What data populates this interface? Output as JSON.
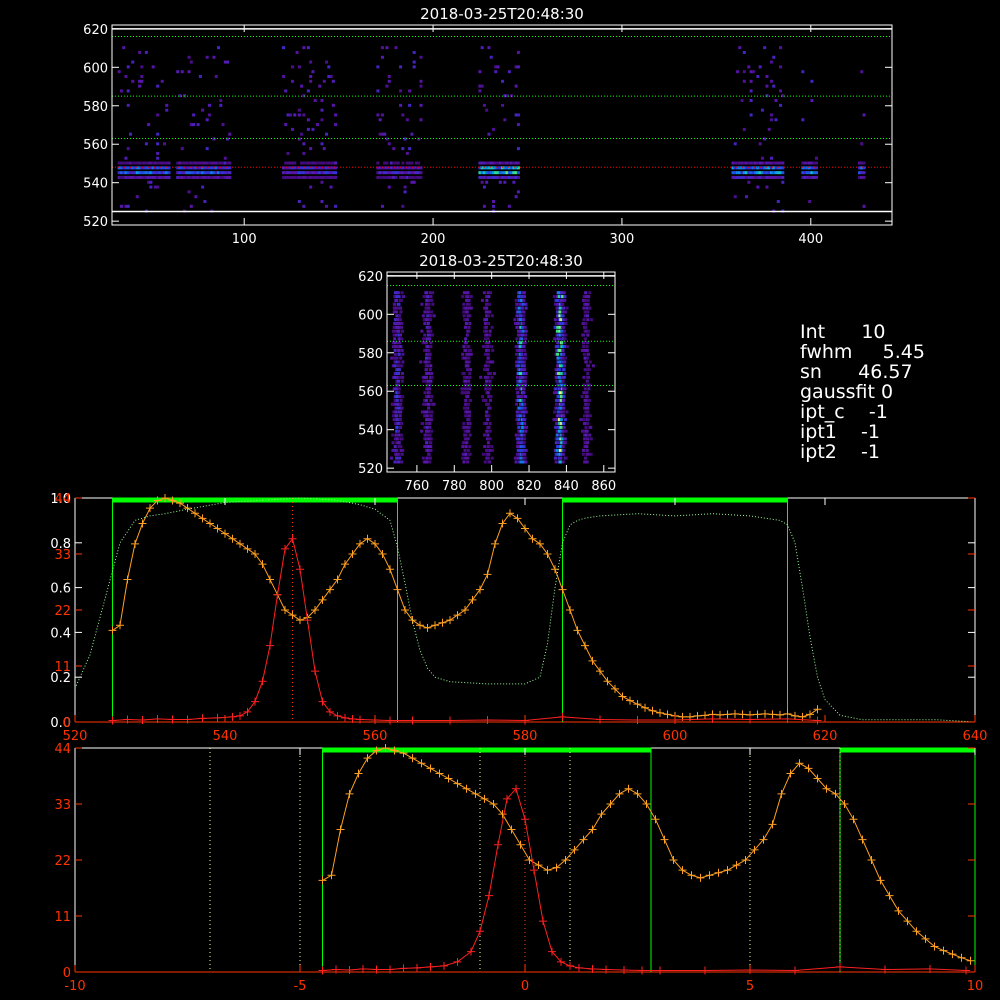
{
  "chart_data": [
    {
      "type": "heatmap",
      "title": "2018-03-25T20:48:30",
      "xlim": [
        30,
        443
      ],
      "ylim": [
        518,
        622
      ],
      "x_ticks": [
        100,
        200,
        300,
        400
      ],
      "y_ticks": [
        520,
        540,
        560,
        580,
        600,
        620
      ],
      "h_lines": [
        {
          "y": 620,
          "style": "solid",
          "color": "#ffffff"
        },
        {
          "y": 616,
          "style": "dotted",
          "color": "#00ff00"
        },
        {
          "y": 585,
          "style": "dotted",
          "color": "#00ff00"
        },
        {
          "y": 563,
          "style": "dotted",
          "color": "#00ff00"
        },
        {
          "y": 548,
          "style": "dotted",
          "color": "#ff0000"
        },
        {
          "y": 525,
          "style": "solid",
          "color": "#ffffff"
        }
      ],
      "blocks": [
        {
          "x0": 33,
          "x1": 60,
          "strength": 0.6
        },
        {
          "x0": 64,
          "x1": 92,
          "strength": 0.55
        },
        {
          "x0": 120,
          "x1": 148,
          "strength": 0.45
        },
        {
          "x0": 170,
          "x1": 193,
          "strength": 0.4
        },
        {
          "x0": 224,
          "x1": 245,
          "strength": 0.8
        },
        {
          "x0": 358,
          "x1": 385,
          "strength": 0.7
        },
        {
          "x0": 395,
          "x1": 403,
          "strength": 0.7
        },
        {
          "x0": 425,
          "x1": 428,
          "strength": 0.6
        }
      ]
    },
    {
      "type": "heatmap",
      "title": "2018-03-25T20:48:30",
      "xlim": [
        744,
        866
      ],
      "ylim": [
        518,
        622
      ],
      "x_ticks": [
        760,
        780,
        800,
        820,
        840,
        860
      ],
      "y_ticks": [
        520,
        540,
        560,
        580,
        600,
        620
      ],
      "h_lines": [
        {
          "y": 620,
          "style": "solid",
          "color": "#ffffff"
        },
        {
          "y": 615,
          "style": "dotted",
          "color": "#00ff00"
        },
        {
          "y": 586,
          "style": "dotted",
          "color": "#00ff00"
        },
        {
          "y": 563,
          "style": "dotted",
          "color": "#00ff00"
        }
      ],
      "stripes": [
        {
          "x": 749,
          "strength": 0.45
        },
        {
          "x": 765,
          "strength": 0.35
        },
        {
          "x": 786,
          "strength": 0.3
        },
        {
          "x": 797,
          "strength": 0.3
        },
        {
          "x": 815,
          "strength": 0.7
        },
        {
          "x": 836,
          "strength": 0.9
        },
        {
          "x": 850,
          "strength": 0.3
        }
      ]
    },
    {
      "type": "line",
      "xlim": [
        520,
        640
      ],
      "ylim_left": [
        0,
        1.0
      ],
      "ylim_right": [
        0,
        44
      ],
      "x_ticks": [
        520,
        540,
        560,
        580,
        600,
        620,
        640
      ],
      "left_ticks": [
        "0.0",
        "0.2",
        "0.4",
        "0.6",
        "0.8",
        "1.0"
      ],
      "right_ticks": [
        {
          "value": 0,
          "label": "0"
        },
        {
          "value": 11,
          "label": "11"
        },
        {
          "value": 22,
          "label": "22"
        },
        {
          "value": 33,
          "label": "33"
        },
        {
          "value": 44,
          "label": "44"
        }
      ],
      "bands": [
        [
          525,
          563
        ],
        [
          585,
          615
        ]
      ],
      "v_lines": [
        {
          "x": 549,
          "color": "#ff3300"
        }
      ],
      "series": [
        {
          "axis": "right",
          "color": "#ffa020",
          "marker": "plus",
          "x": [
            525,
            526,
            527,
            528,
            529,
            530,
            531,
            532,
            533,
            534,
            535,
            536,
            537,
            538,
            539,
            540,
            541,
            542,
            543,
            544,
            545,
            546,
            547,
            548,
            549,
            550,
            551,
            552,
            553,
            554,
            555,
            556,
            557,
            558,
            559,
            560,
            561,
            562,
            563,
            564,
            565,
            566,
            567,
            568,
            569,
            570,
            571,
            572,
            573,
            574,
            575,
            576,
            577,
            578,
            579,
            580,
            581,
            582,
            583,
            584,
            585,
            586,
            587,
            588,
            589,
            590,
            591,
            592,
            593,
            594,
            595,
            596,
            597,
            598,
            599,
            600,
            601,
            602,
            603,
            604,
            605,
            606,
            607,
            608,
            609,
            610,
            611,
            612,
            613,
            614,
            615,
            616,
            617,
            618,
            619
          ],
          "y": [
            18,
            19,
            28,
            35,
            39,
            42,
            43.5,
            44,
            43.5,
            43,
            42,
            41,
            40,
            39,
            38,
            37,
            36,
            35,
            34,
            33,
            31,
            28,
            25,
            22,
            21,
            20,
            20.5,
            22,
            24,
            26,
            28,
            31,
            33,
            35,
            36,
            35,
            33,
            30,
            26,
            22,
            20,
            19,
            18.5,
            19,
            19.5,
            20,
            21,
            22,
            24,
            26,
            29,
            35,
            39,
            41,
            40,
            38,
            36,
            35,
            33,
            30,
            26,
            22,
            18,
            15,
            12,
            10,
            8,
            6.5,
            5,
            4.2,
            3.5,
            2.8,
            2.2,
            1.8,
            1.5,
            1.2,
            1,
            1,
            1.2,
            1.3,
            1.5,
            1.4,
            1.5,
            1.6,
            1.5,
            1.4,
            1.5,
            1.6,
            1.5,
            1.4,
            1.6,
            1.2,
            1,
            1.5,
            2.5
          ]
        },
        {
          "axis": "right",
          "color": "#ff2020",
          "marker": "plus",
          "x": [
            525,
            527,
            529,
            531,
            533,
            535,
            537,
            539,
            541,
            542,
            543,
            544,
            545,
            546,
            547,
            548,
            549,
            550,
            551,
            552,
            553,
            554,
            555,
            556,
            557,
            558,
            560,
            562,
            565,
            570,
            575,
            580,
            585,
            590,
            595,
            600,
            605,
            610,
            615,
            619
          ],
          "y": [
            0.3,
            0.5,
            0.4,
            0.6,
            0.5,
            0.5,
            0.7,
            0.8,
            1,
            1.2,
            2,
            4,
            8,
            15,
            25,
            34,
            36,
            30,
            20,
            10,
            4,
            2,
            1.2,
            0.8,
            0.6,
            0.5,
            0.4,
            0.3,
            0.3,
            0.3,
            0.4,
            0.3,
            1,
            0.5,
            0.4,
            0.4,
            0.6,
            0.5,
            0.6,
            0.3
          ]
        },
        {
          "axis": "left",
          "color": "#99ff99",
          "style": "dotted",
          "x": [
            520,
            522,
            524,
            526,
            528,
            530,
            532,
            535,
            540,
            545,
            550,
            555,
            558,
            560,
            562,
            563,
            564,
            565,
            566,
            567,
            568,
            570,
            575,
            580,
            582,
            583,
            584,
            585,
            586,
            587,
            588,
            590,
            595,
            600,
            605,
            610,
            612,
            614,
            615,
            616,
            617,
            618,
            619,
            620,
            622,
            625,
            630,
            635,
            640
          ],
          "y": [
            0.15,
            0.3,
            0.55,
            0.8,
            0.9,
            0.92,
            0.93,
            0.95,
            0.98,
            0.99,
            1.0,
            0.99,
            0.97,
            0.95,
            0.9,
            0.78,
            0.62,
            0.45,
            0.32,
            0.24,
            0.2,
            0.18,
            0.17,
            0.17,
            0.2,
            0.35,
            0.6,
            0.8,
            0.88,
            0.9,
            0.91,
            0.92,
            0.93,
            0.92,
            0.93,
            0.92,
            0.91,
            0.9,
            0.88,
            0.8,
            0.6,
            0.38,
            0.2,
            0.1,
            0.03,
            0.01,
            0.01,
            0.01,
            0.0
          ]
        }
      ]
    },
    {
      "type": "line",
      "xlim": [
        -10,
        10
      ],
      "ylim": [
        0,
        44
      ],
      "x_ticks": [
        -10,
        -5,
        0,
        5,
        10
      ],
      "y_ticks": [
        {
          "value": 0,
          "label": "0"
        },
        {
          "value": 11,
          "label": "11"
        },
        {
          "value": 22,
          "label": "22"
        },
        {
          "value": 33,
          "label": "33"
        },
        {
          "value": 44,
          "label": "44"
        }
      ],
      "bands": [
        [
          -4.5,
          2.8
        ],
        [
          7.0,
          10
        ]
      ],
      "v_lines": [
        {
          "x": -7,
          "color": "#ffff99"
        },
        {
          "x": -5,
          "color": "#ffff99"
        },
        {
          "x": -1,
          "color": "#ffff99"
        },
        {
          "x": 0,
          "color": "#ff3300"
        },
        {
          "x": 1,
          "color": "#ffff99"
        },
        {
          "x": 5,
          "color": "#ffff99"
        },
        {
          "x": 7,
          "color": "#ffff99"
        }
      ],
      "series": [
        {
          "color": "#ffa020",
          "marker": "plus",
          "x": [
            -4.5,
            -4.3,
            -4.1,
            -3.9,
            -3.7,
            -3.5,
            -3.3,
            -3.1,
            -2.9,
            -2.7,
            -2.5,
            -2.3,
            -2.1,
            -1.9,
            -1.7,
            -1.5,
            -1.3,
            -1.1,
            -0.9,
            -0.7,
            -0.5,
            -0.3,
            -0.1,
            0.1,
            0.3,
            0.5,
            0.7,
            0.9,
            1.1,
            1.3,
            1.5,
            1.7,
            1.9,
            2.1,
            2.3,
            2.5,
            2.7,
            2.9,
            3.1,
            3.3,
            3.5,
            3.7,
            3.9,
            4.1,
            4.3,
            4.5,
            4.7,
            4.9,
            5.1,
            5.3,
            5.5,
            5.7,
            5.9,
            6.1,
            6.3,
            6.5,
            6.7,
            6.9,
            7.1,
            7.3,
            7.5,
            7.7,
            7.9,
            8.1,
            8.3,
            8.5,
            8.7,
            8.9,
            9.1,
            9.3,
            9.5,
            9.7,
            9.9
          ],
          "y": [
            18,
            19,
            28,
            35,
            39,
            42,
            43.5,
            44,
            43.5,
            43,
            42,
            41,
            40,
            39,
            38,
            37,
            36,
            35,
            34,
            33,
            31,
            28,
            25,
            22,
            21,
            20,
            20.5,
            22,
            24,
            26,
            28,
            31,
            33,
            35,
            36,
            35,
            33,
            30,
            26,
            22,
            20,
            19,
            18.5,
            19,
            19.5,
            20,
            21,
            22,
            24,
            26,
            29,
            35,
            39,
            41,
            40,
            38,
            36,
            35,
            33,
            30,
            26,
            22,
            18,
            15,
            12,
            10,
            8,
            6.5,
            5,
            4.2,
            3.5,
            2.8,
            2.2
          ]
        },
        {
          "color": "#ff2020",
          "marker": "plus",
          "x": [
            -4.5,
            -4.2,
            -3.9,
            -3.6,
            -3.3,
            -3.0,
            -2.7,
            -2.4,
            -2.1,
            -1.8,
            -1.5,
            -1.2,
            -1.0,
            -0.8,
            -0.6,
            -0.4,
            -0.2,
            0.0,
            0.2,
            0.4,
            0.6,
            0.8,
            1.0,
            1.2,
            1.5,
            1.8,
            2.2,
            2.6,
            3.0,
            4.0,
            5.0,
            6.0,
            7.0,
            8.0,
            9.0,
            9.8
          ],
          "y": [
            0.3,
            0.5,
            0.4,
            0.6,
            0.5,
            0.5,
            0.7,
            0.8,
            1,
            1.2,
            2,
            4,
            8,
            15,
            25,
            34,
            36,
            30,
            20,
            10,
            4,
            2,
            1.2,
            0.8,
            0.6,
            0.5,
            0.4,
            0.3,
            0.3,
            0.3,
            0.4,
            0.3,
            1,
            0.5,
            0.6,
            0.3
          ]
        }
      ]
    }
  ],
  "info": {
    "lines": [
      "Int      10",
      "fwhm     5.45",
      "sn      46.57",
      "gaussfit 0",
      "ipt_c    -1",
      "ipt1    -1",
      "ipt2    -1"
    ]
  },
  "colors": {
    "axis": "#ffffff",
    "axis_bottom": "#ff3300",
    "band": "#00ff00",
    "orange": "#ffa020",
    "red": "#ff2020",
    "right_tick_label": "#ff3300"
  }
}
